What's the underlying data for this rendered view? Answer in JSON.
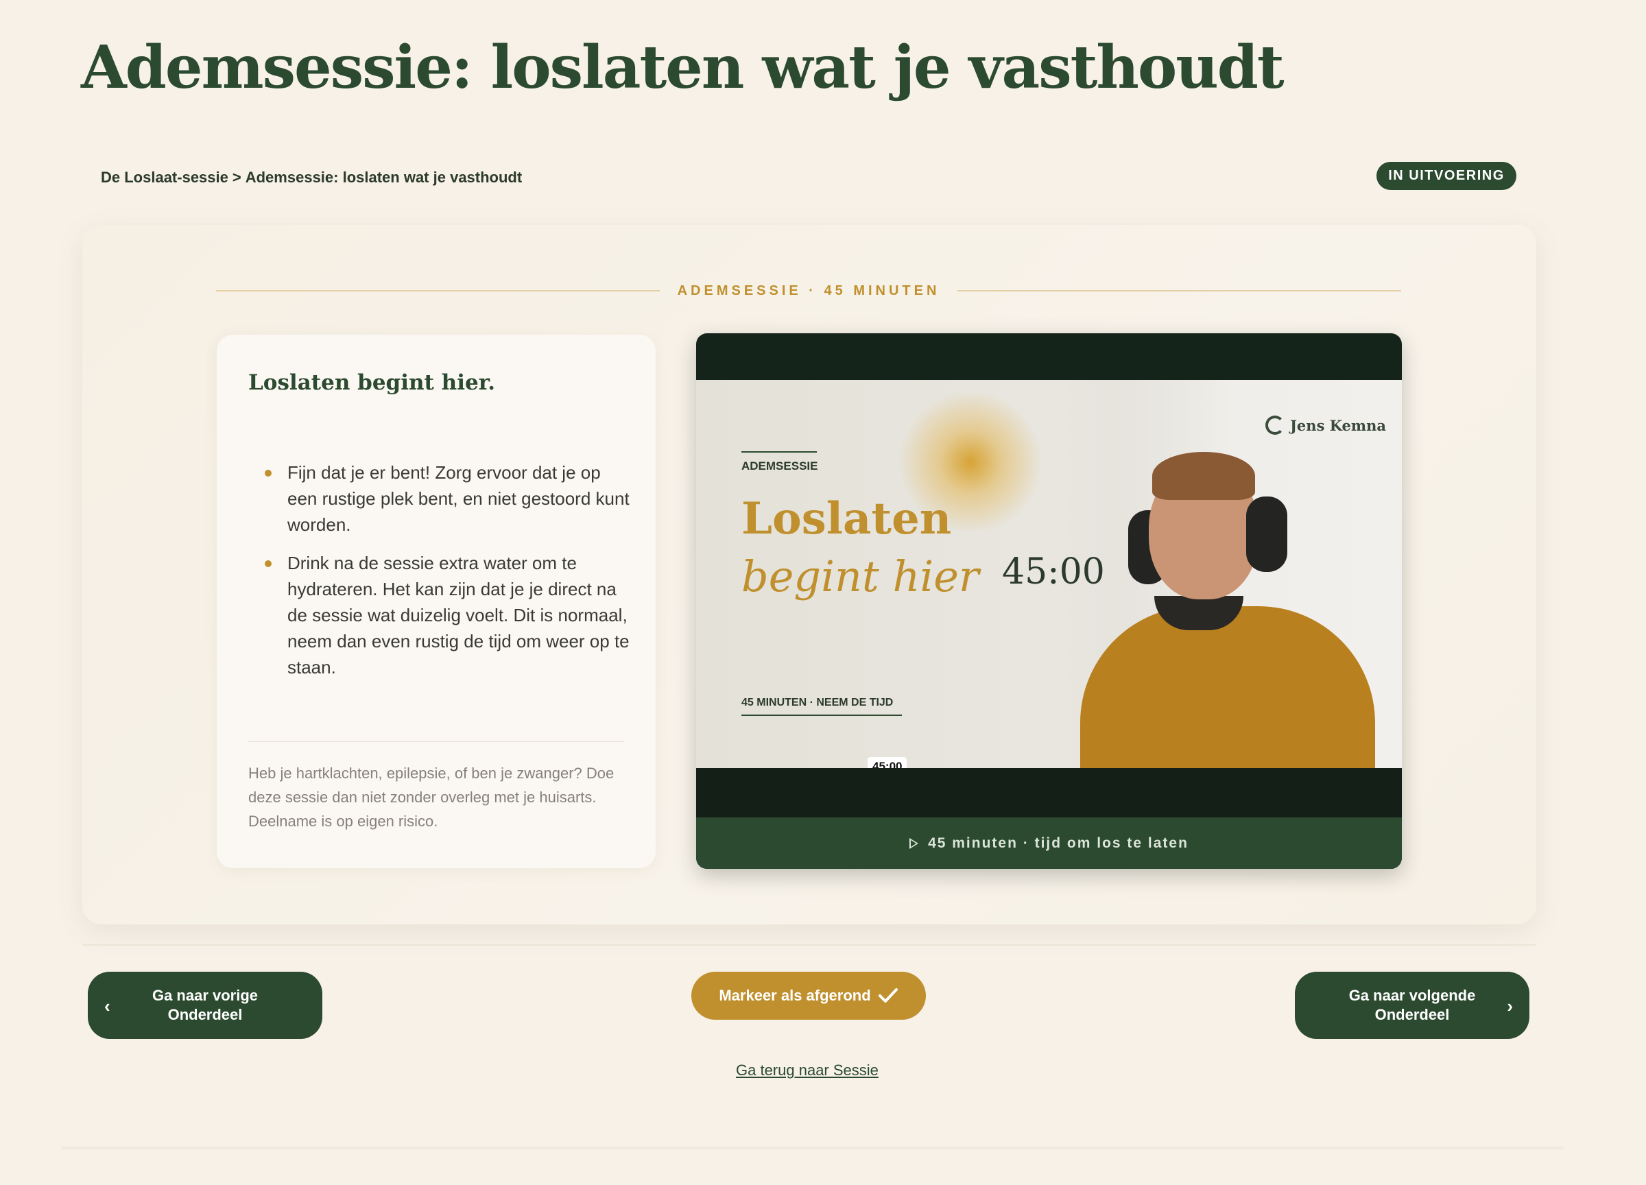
{
  "page": {
    "title": "Ademsessie: loslaten wat je vasthoudt"
  },
  "breadcrumb": {
    "parent": "De Loslaat-sessie",
    "separator": ">",
    "current": "Ademsessie: loslaten wat je vasthoudt"
  },
  "status_badge": "IN UITVOERING",
  "section_label": "ADEMSESSIE · 45 MINUTEN",
  "info": {
    "heading": "Loslaten begint hier.",
    "bullets": [
      "Fijn dat je er bent! Zorg ervoor dat je op een rustige plek bent, en niet gestoord kunt worden.",
      "Drink na de sessie extra water om te hydrateren. Het kan zijn dat je je direct na de sessie wat duizelig voelt. Dit is normaal, neem dan even rustig de tijd om weer op te staan."
    ],
    "disclaimer": "Heb je hartklachten, epilepsie, of ben je zwanger? Doe deze sessie dan niet zonder overleg met je huisarts. Deelname is op eigen risico."
  },
  "video": {
    "brand": "Jens Kemna",
    "kicker": "ADEMSESSIE",
    "title_line1": "Loslaten",
    "title_line2": "begint hier",
    "timer": "45:00",
    "footnote": "45 MINUTEN · NEEM DE TIJD",
    "time_tooltip": "45:00",
    "progress": 0,
    "control_icons": [
      "volume-icon",
      "captions-icon",
      "settings-icon",
      "speed-icon",
      "transcript-icon",
      "pip-icon",
      "fullscreen-icon",
      "vimeo-icon"
    ],
    "caption": "45 minuten · tijd om los te laten"
  },
  "actions": {
    "prev_line1": "Ga naar vorige",
    "prev_line2": "Onderdeel",
    "mark_done": "Markeer als afgerond",
    "next_line1": "Ga naar volgende",
    "next_line2": "Onderdeel",
    "back_link": "Ga terug naar Sessie"
  },
  "colors": {
    "accent_green": "#2b4a2f",
    "accent_gold": "#c0902e",
    "background": "#f7f1e8"
  }
}
